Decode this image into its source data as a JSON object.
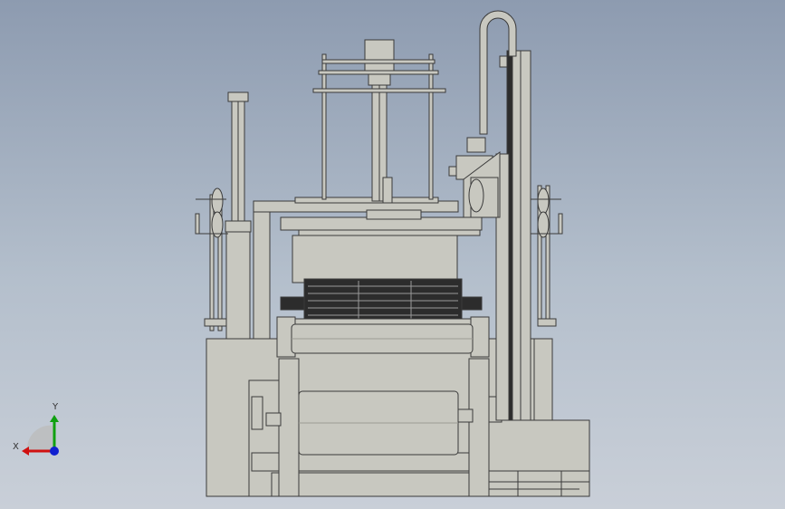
{
  "viewport": {
    "background_top": "#8d9bb0",
    "background_bottom": "#c9cfd8",
    "part_fill": "#c8c8c0",
    "part_stroke": "#3a3a3a",
    "dark_fill": "#2c2c2c"
  },
  "triad": {
    "x_label": "X",
    "y_label": "Y",
    "x_color": "#d01010",
    "y_color": "#10a010",
    "z_color": "#1020d0"
  }
}
